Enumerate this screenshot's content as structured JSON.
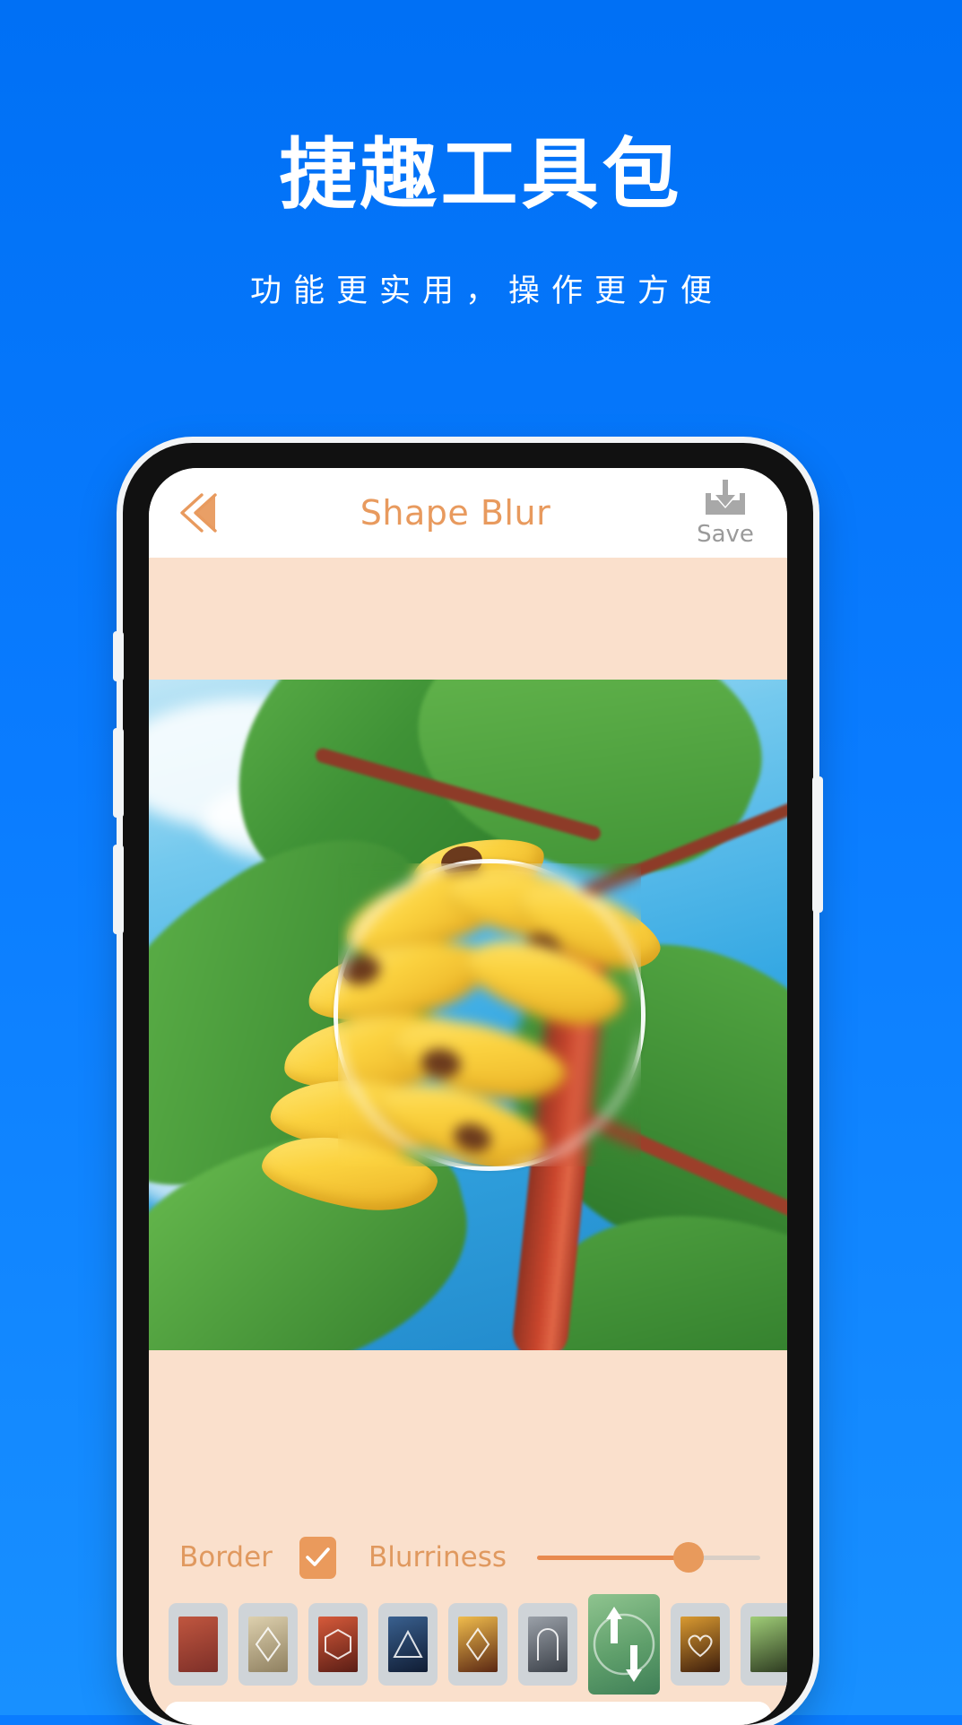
{
  "hero": {
    "title": "捷趣工具包",
    "subtitle": "功能更实用，操作更方便"
  },
  "colors": {
    "background_blue": "#0a7cff",
    "accent_orange": "#e89a5e",
    "panel_peach": "#fae0cc",
    "save_gray": "#9a9a9a",
    "checkbox_orange": "#ea9a5c",
    "slider_fill": "#e88a4e",
    "slider_track": "#d9cfc6",
    "thumb_bg": "#cfd4d8"
  },
  "app": {
    "header": {
      "back_icon": "chevron-double-left-icon",
      "title": "Shape Blur",
      "save_icon": "download-tray-icon",
      "save_label": "Save"
    },
    "canvas": {
      "image_description": "banana-tree-photo",
      "overlay_shape": "circle",
      "overlay_border_color": "#ffffff"
    },
    "controls": {
      "border_label": "Border",
      "border_checked": true,
      "check_icon": "checkmark-icon",
      "blurriness_label": "Blurriness",
      "blurriness_value": 68
    },
    "shape_thumbnails": [
      {
        "name": "shape-preset-1",
        "shape": "none",
        "selected": false,
        "tint_a": "#b34b3a",
        "tint_b": "#7d2f28"
      },
      {
        "name": "shape-preset-2",
        "shape": "diamond",
        "selected": false,
        "tint_a": "#d8cbaa",
        "tint_b": "#8f8060"
      },
      {
        "name": "shape-preset-3",
        "shape": "hexagon",
        "selected": false,
        "tint_a": "#c8442e",
        "tint_b": "#5a1d15"
      },
      {
        "name": "shape-preset-4",
        "shape": "triangle",
        "selected": false,
        "tint_a": "#2c4b7a",
        "tint_b": "#101c33"
      },
      {
        "name": "shape-preset-5",
        "shape": "diamond",
        "selected": false,
        "tint_a": "#e0a83c",
        "tint_b": "#5a2713"
      },
      {
        "name": "shape-preset-6",
        "shape": "arch",
        "selected": false,
        "tint_a": "#8b8f96",
        "tint_b": "#3b4048"
      },
      {
        "name": "shape-preset-7",
        "shape": "circle",
        "selected": true,
        "tint_a": "#8fc48f",
        "tint_b": "#3f7f57"
      },
      {
        "name": "shape-preset-8",
        "shape": "heart",
        "selected": false,
        "tint_a": "#c98a2a",
        "tint_b": "#3d1d0c"
      },
      {
        "name": "shape-preset-9",
        "shape": "none",
        "selected": false,
        "tint_a": "#8fbf6a",
        "tint_b": "#2d3a20"
      }
    ]
  }
}
